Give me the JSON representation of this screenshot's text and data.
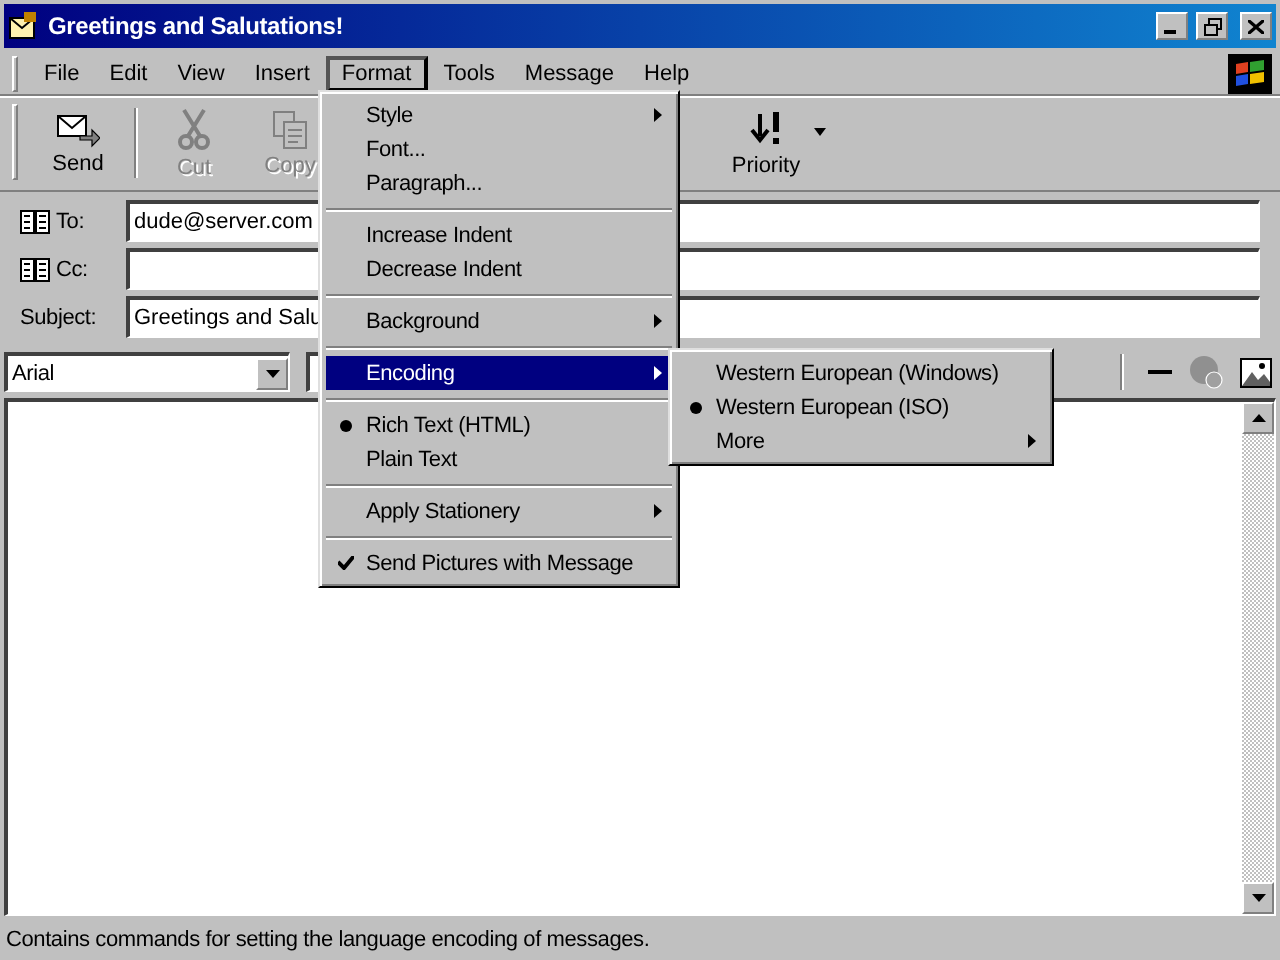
{
  "window": {
    "title": "Greetings and Salutations!"
  },
  "menubar": [
    {
      "label": "File",
      "selected": false
    },
    {
      "label": "Edit",
      "selected": false
    },
    {
      "label": "View",
      "selected": false
    },
    {
      "label": "Insert",
      "selected": false
    },
    {
      "label": "Format",
      "selected": true
    },
    {
      "label": "Tools",
      "selected": false
    },
    {
      "label": "Message",
      "selected": false
    },
    {
      "label": "Help",
      "selected": false
    }
  ],
  "toolbar": [
    {
      "label": "Send",
      "disabled": false
    },
    {
      "label": "Cut",
      "disabled": true
    },
    {
      "label": "Copy",
      "disabled": true
    },
    {
      "label": "Priority",
      "disabled": false
    }
  ],
  "header": [
    {
      "label": "To:",
      "book": true,
      "value": "dude@server.com"
    },
    {
      "label": "Cc:",
      "book": true
    },
    {
      "label": "Subject:",
      "book": false,
      "value": "Greetings and Salu"
    }
  ],
  "format_bar": {
    "font": "Arial"
  },
  "format_menu": [
    {
      "kind": "command",
      "label": "Style",
      "submenu": true,
      "selected": false
    },
    {
      "kind": "command",
      "label": "Font...",
      "submenu": false,
      "selected": false
    },
    {
      "kind": "command",
      "label": "Paragraph...",
      "submenu": false,
      "selected": false
    },
    {
      "kind": "separator"
    },
    {
      "kind": "command",
      "label": "Increase Indent",
      "submenu": false,
      "selected": false
    },
    {
      "kind": "command",
      "label": "Decrease Indent",
      "submenu": false,
      "selected": false
    },
    {
      "kind": "separator"
    },
    {
      "kind": "command",
      "label": "Background",
      "submenu": true,
      "selected": false
    },
    {
      "kind": "separator"
    },
    {
      "kind": "command",
      "label": "Encoding",
      "submenu": true,
      "selected": true
    },
    {
      "kind": "separator"
    },
    {
      "kind": "radio",
      "label": "Rich Text (HTML)",
      "checked": true,
      "submenu": false,
      "selected": false
    },
    {
      "kind": "radio",
      "label": "Plain Text",
      "checked": false,
      "submenu": false,
      "selected": false
    },
    {
      "kind": "separator"
    },
    {
      "kind": "command",
      "label": "Apply Stationery",
      "submenu": true,
      "selected": false
    },
    {
      "kind": "separator"
    },
    {
      "kind": "check",
      "label": "Send Pictures with Message",
      "checked": true,
      "submenu": false,
      "selected": false
    }
  ],
  "encoding_menu": [
    {
      "kind": "radio",
      "label": "Western European (Windows)",
      "checked": false,
      "submenu": false
    },
    {
      "kind": "radio",
      "label": "Western European (ISO)",
      "checked": true,
      "submenu": false
    },
    {
      "kind": "command",
      "label": "More",
      "submenu": true
    }
  ],
  "status_bar": "Contains commands for setting the language encoding of messages."
}
